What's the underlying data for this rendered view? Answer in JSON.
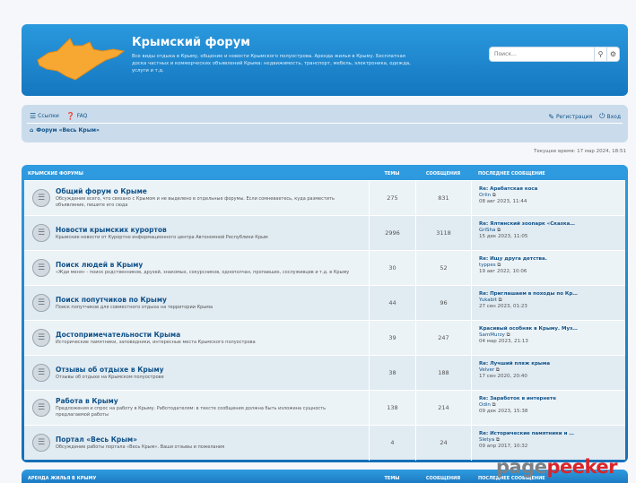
{
  "header": {
    "title": "Крымский форум",
    "description": "Все виды отдыха в Крыму, общение и новости Крымского полуострова. Аренда жилья в Крыму. Бесплатная доска частных и коммерческих объявлений Крыма: недвижимость, транспорт, мебель, электроника, одежда, услуги и т.д.",
    "search_placeholder": "Поиск…",
    "colors": {
      "header": "#1c8ad4",
      "navbar": "#cadceb",
      "link": "#105289"
    }
  },
  "nav": {
    "links_label": "Ссылки",
    "faq_label": "FAQ",
    "register_label": "Регистрация",
    "login_label": "Вход",
    "breadcrumb": "Форум «Весь Крым»"
  },
  "time_text": "Текущее время: 17 мар 2024, 18:51",
  "forum_section": {
    "title": "КРЫМСКИЕ ФОРУМЫ",
    "col_topics": "ТЕМЫ",
    "col_posts": "СООБЩЕНИЯ",
    "col_last": "ПОСЛЕДНЕЕ СООБЩЕНИЕ",
    "rows": [
      {
        "title": "Общий форум о Крыме",
        "desc": "Обсуждение всего, что связано с Крымом и не выделено в отдельные форумы. Если сомневаетесь, куда разместить объявление, пишите его сюда",
        "topics": "275",
        "posts": "831",
        "last_title": "Re: Арабатская коса",
        "last_author": "Orlin",
        "last_date": "08 авг 2023, 11:44"
      },
      {
        "title": "Новости крымских курортов",
        "desc": "Крымские новости от Курортно информационного центра Автономной Республики Крым",
        "topics": "2996",
        "posts": "3118",
        "last_title": "Re: Ялтинский зоопарк «Сказка…",
        "last_author": "GriSha",
        "last_date": "15 дек 2023, 11:05"
      },
      {
        "title": "Поиск людей в Крыму",
        "desc": "«Жди меня» - поиск родственников, друзей, знакомых, сокурсников, однополчан, пропавших, сослуживцев и т.д. в Крыму",
        "topics": "30",
        "posts": "52",
        "last_title": "Re: Ищу друга детства.",
        "last_author": "typpes",
        "last_date": "19 авг 2022, 10:06"
      },
      {
        "title": "Поиск попутчиков по Крыму",
        "desc": "Поиск попутчиков для совместного отдыха на территории Крыма",
        "topics": "44",
        "posts": "96",
        "last_title": "Re: Приглашаем в походы по Кр…",
        "last_author": "Yukabit",
        "last_date": "27 сен 2023, 01:23"
      },
      {
        "title": "Достопримечательности Крыма",
        "desc": "Исторические памятники, заповедники, интересные места Крымского полуострова",
        "topics": "39",
        "posts": "247",
        "last_title": "Красивый особняк в Крыму. Муз…",
        "last_author": "SamMurzy",
        "last_date": "04 мар 2023, 21:13"
      },
      {
        "title": "Отзывы об отдыхе в Крыму",
        "desc": "Отзывы об отдыхе на Крымском полуострове",
        "topics": "38",
        "posts": "188",
        "last_title": "Re: Лучший пляж крыма",
        "last_author": "Velver",
        "last_date": "17 сен 2020, 20:40"
      },
      {
        "title": "Работа в Крыму",
        "desc": "Предложения и спрос на работу в Крыму. Работодателям: в тексте сообщения должна быть изложена сущность предлагаемой работы",
        "topics": "138",
        "posts": "214",
        "last_title": "Re: Заработок в интернете",
        "last_author": "Odin",
        "last_date": "09 дек 2023, 15:38"
      },
      {
        "title": "Портал «Весь Крым»",
        "desc": "Обсуждение работы портала «Весь Крым». Ваши отзывы и пожелания",
        "topics": "4",
        "posts": "24",
        "last_title": "Re: Исторические памятники и …",
        "last_author": "Sletya",
        "last_date": "09 апр 2017, 10:32"
      }
    ]
  },
  "forum_section2": {
    "title": "АРЕНДА ЖИЛЬЯ В КРЫМУ",
    "col_topics": "ТЕМЫ",
    "col_posts": "СООБЩЕНИЯ",
    "col_last": "ПОСЛЕДНЕЕ СООБЩЕНИЕ"
  },
  "watermark": {
    "part1": "page",
    "part2": "peeker"
  }
}
